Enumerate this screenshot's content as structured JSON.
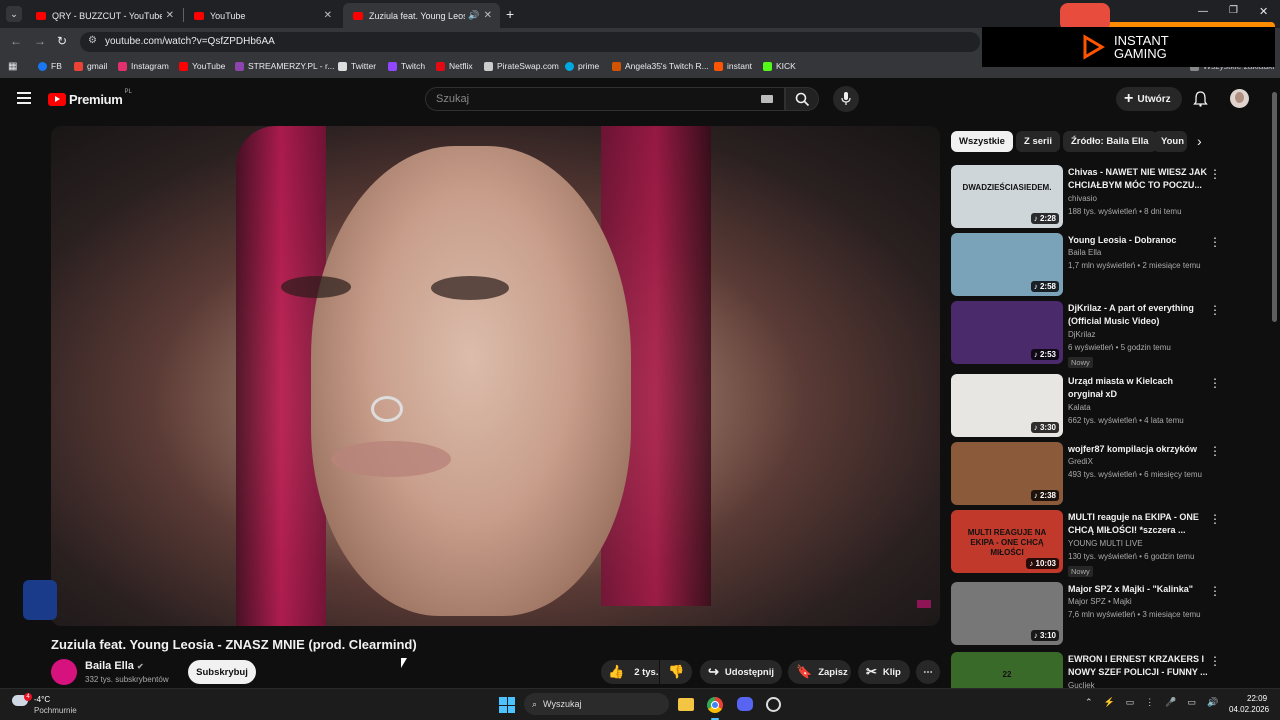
{
  "browser": {
    "tabs": [
      {
        "title": "QRY - BUZZCUT - YouTube"
      },
      {
        "title": "YouTube"
      },
      {
        "title": "Zuziula feat. Young Leosia"
      }
    ],
    "url": "youtube.com/watch?v=QsfZPDHb6AA",
    "bookmarks": [
      {
        "label": "FB",
        "color": "#1877f2"
      },
      {
        "label": "gmail",
        "color": "#ea4335"
      },
      {
        "label": "Instagram",
        "color": "#e1306c"
      },
      {
        "label": "YouTube",
        "color": "#ff0000"
      },
      {
        "label": "STREAMERZY.PL - r...",
        "color": "#8e44ad"
      },
      {
        "label": "Twitter",
        "color": "#dddddd"
      },
      {
        "label": "Twitch",
        "color": "#9146ff"
      },
      {
        "label": "Netflix",
        "color": "#e50914"
      },
      {
        "label": "PirateSwap.com",
        "color": "#cccccc"
      },
      {
        "label": "prime",
        "color": "#00a8e1"
      },
      {
        "label": "Angela35's Twitch R...",
        "color": "#d35400"
      },
      {
        "label": "instant",
        "color": "#ff5500"
      },
      {
        "label": "KICK",
        "color": "#53fc18"
      }
    ],
    "bookmarks_overflow": "Wszystkie zakładki"
  },
  "ad": {
    "line1": "INSTANT",
    "line2": "GAMING",
    "accent": "#ff5500"
  },
  "youtube": {
    "logo": "Premium",
    "region": "PL",
    "search_placeholder": "Szukaj",
    "create_label": "Utwórz",
    "video_title": "Zuziula feat. Young Leosia - ZNASZ MNIE (prod. Clearmind)",
    "channel": {
      "name": "Baila Ella",
      "subs": "332 tys. subskrybentów",
      "subscribe_label": "Subskrybuj"
    },
    "actions": {
      "likes": "2 tys.",
      "share": "Udostępnij",
      "save": "Zapisz",
      "clip": "Klip"
    },
    "chips": [
      "Wszystkie",
      "Z serii",
      "Źródło: Baila Ella",
      "Youn"
    ],
    "recommendations": [
      {
        "title": "Chivas - NAWET NIE WIESZ JAK CHCIAŁBYM MÓC TO POCZU...",
        "channel": "chivasio",
        "meta": "188 tys. wyświetleń • 8 dni temu",
        "duration": "2:28",
        "badge": "",
        "thumb_text": "DWADZIEŚCIASIEDEM.",
        "thumb_color": "#cfd6da"
      },
      {
        "title": "Young Leosia - Dobranoc",
        "channel": "Baila Ella",
        "meta": "1,7 mln wyświetleń • 2 miesiące temu",
        "duration": "2:58",
        "badge": "",
        "thumb_text": "",
        "thumb_color": "#7aa2b8"
      },
      {
        "title": "DjKrilaz - A part of everything (Official Music Video)",
        "channel": "DjKrilaz",
        "meta": "6 wyświetleń • 5 godzin temu",
        "duration": "2:53",
        "badge": "Nowy",
        "thumb_text": "",
        "thumb_color": "#4a2a6a"
      },
      {
        "title": "Urząd miasta w Kielcach oryginał xD",
        "channel": "Kalata",
        "meta": "662 tys. wyświetleń • 4 lata temu",
        "duration": "3:30",
        "badge": "",
        "thumb_text": "",
        "thumb_color": "#e8e6e2"
      },
      {
        "title": "wojfer87 kompilacja okrzyków",
        "channel": "GrediX",
        "meta": "493 tys. wyświetleń • 6 miesięcy temu",
        "duration": "2:38",
        "badge": "",
        "thumb_text": "",
        "thumb_color": "#8a5a3a"
      },
      {
        "title": "MULTI reaguje na EKIPA - ONE CHCĄ MIŁOŚCI! *szczera ...",
        "channel": "YOUNG MULTI LIVE",
        "meta": "130 tys. wyświetleń • 6 godzin temu",
        "duration": "10:03",
        "badge": "Nowy",
        "thumb_text": "MULTI REAGUJE NA EKIPA - ONE CHCĄ MIŁOŚCI",
        "thumb_color": "#c0392b"
      },
      {
        "title": "Major SPZ x Majki - \"Kalinka\"",
        "channel": "Major SPZ • Majki",
        "meta": "7,6 mln wyświetleń • 3 miesiące temu",
        "duration": "3:10",
        "badge": "",
        "thumb_text": "",
        "thumb_color": "#777777"
      },
      {
        "title": "EWRON I ERNEST KRZAKERS I NOWY SZEF POLICJI - FUNNY ...",
        "channel": "Gucliek",
        "meta": "",
        "duration": "",
        "badge": "",
        "thumb_text": "22",
        "thumb_color": "#3a6a2a"
      }
    ]
  },
  "taskbar": {
    "temp": "-4°C",
    "weather": "Pochmurnie",
    "search": "Wyszukaj",
    "time": "22:09",
    "date": "04.02.2026",
    "notif_count": "4"
  }
}
